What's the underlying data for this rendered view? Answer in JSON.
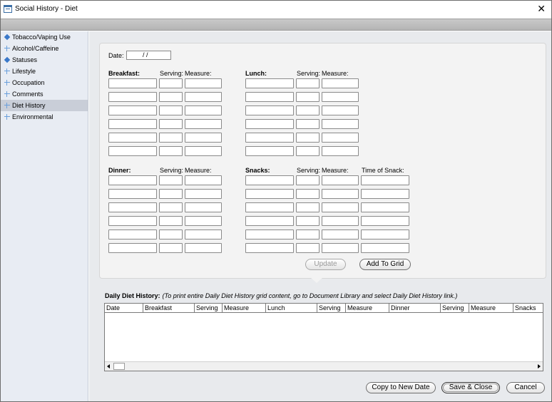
{
  "window": {
    "title": "Social History - Diet",
    "close_glyph": "✕"
  },
  "sidebar": {
    "items": [
      {
        "label": "Tobacco/Vaping Use",
        "icon": "filled-diamond-icon"
      },
      {
        "label": "Alcohol/Caffeine",
        "icon": "plus-icon"
      },
      {
        "label": "Statuses",
        "icon": "filled-diamond-icon"
      },
      {
        "label": "Lifestyle",
        "icon": "plus-icon"
      },
      {
        "label": "Occupation",
        "icon": "plus-icon"
      },
      {
        "label": "Comments",
        "icon": "plus-icon"
      },
      {
        "label": "Diet History",
        "icon": "plus-icon",
        "selected": true
      },
      {
        "label": "Environmental",
        "icon": "plus-icon"
      }
    ]
  },
  "form": {
    "date_label": "Date:",
    "date_value": "/ /",
    "breakfast": {
      "label": "Breakfast:",
      "serving_label": "Serving:",
      "measure_label": "Measure:"
    },
    "lunch": {
      "label": "Lunch:",
      "serving_label": "Serving:",
      "measure_label": "Measure:"
    },
    "dinner": {
      "label": "Dinner:",
      "serving_label": "Serving:",
      "measure_label": "Measure:"
    },
    "snacks": {
      "label": "Snacks:",
      "serving_label": "Serving:",
      "measure_label": "Measure:",
      "time_label": "Time of Snack:"
    },
    "update_button": "Update",
    "add_button": "Add To Grid"
  },
  "grid": {
    "title": "Daily Diet History:",
    "note": "(To print entire Daily Diet History grid content, go to Document Library and select Daily Diet History link.)",
    "columns": [
      "Date",
      "Breakfast",
      "Serving",
      "Measure",
      "Lunch",
      "Serving",
      "Measure",
      "Dinner",
      "Serving",
      "Measure",
      "Snacks"
    ]
  },
  "footer": {
    "copy_button": "Copy to New Date",
    "save_button": "Save & Close",
    "cancel_button": "Cancel"
  },
  "colors": {
    "accent": "#3a78c9",
    "selected_row": "#c9ced8",
    "sidebar_bg": "#e8ecf3"
  }
}
